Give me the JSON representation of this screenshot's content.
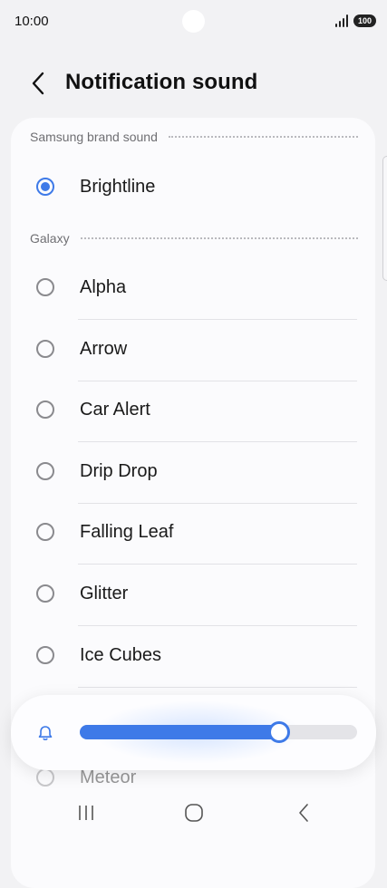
{
  "status_bar": {
    "time": "10:00",
    "battery": "100"
  },
  "header": {
    "title": "Notification sound",
    "back_icon": "chevron-left-icon"
  },
  "sections": [
    {
      "label": "Samsung brand sound",
      "items": [
        {
          "label": "Brightline",
          "selected": true
        }
      ]
    },
    {
      "label": "Galaxy",
      "items": [
        {
          "label": "Alpha",
          "selected": false
        },
        {
          "label": "Arrow",
          "selected": false
        },
        {
          "label": "Car Alert",
          "selected": false
        },
        {
          "label": "Drip Drop",
          "selected": false
        },
        {
          "label": "Falling Leaf",
          "selected": false
        },
        {
          "label": "Glitter",
          "selected": false
        },
        {
          "label": "Ice Cubes",
          "selected": false
        },
        {
          "label": "Meteor",
          "selected": false
        }
      ]
    }
  ],
  "volume": {
    "icon": "bell-icon",
    "level": 0.72
  },
  "nav": {
    "recent_icon": "recent-apps-icon",
    "home_icon": "home-icon",
    "back_icon": "back-icon"
  },
  "colors": {
    "accent": "#3e7ae8",
    "background": "#f2f2f4",
    "card": "#fbfbfd"
  }
}
